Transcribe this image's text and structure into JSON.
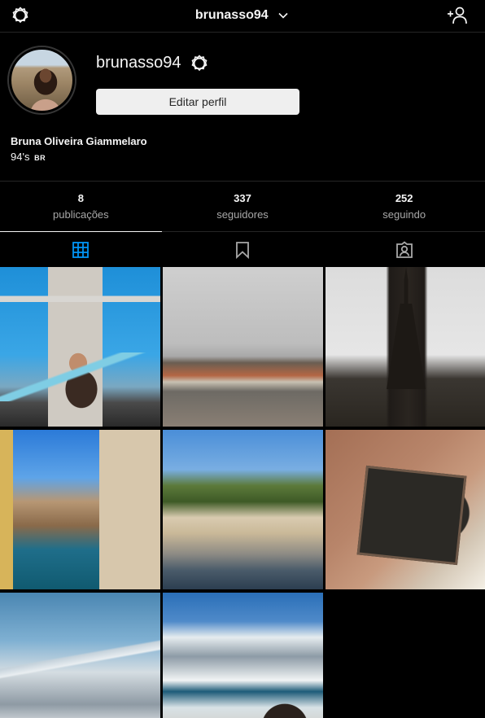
{
  "header": {
    "username": "brunasso94",
    "settings_icon": "gear-icon",
    "dropdown_icon": "chevron-down-icon",
    "add_user_icon": "add-user-icon"
  },
  "profile": {
    "username": "brunasso94",
    "edit_button": "Editar perfil",
    "full_name": "Bruna Oliveira Giammelaro",
    "bio_text": "94's",
    "bio_flag": "BR"
  },
  "stats": [
    {
      "value": "8",
      "label": "publicações"
    },
    {
      "value": "337",
      "label": "seguidores"
    },
    {
      "value": "252",
      "label": "seguindo"
    }
  ],
  "tabs": [
    {
      "icon": "grid-icon",
      "active": true
    },
    {
      "icon": "bookmark-icon",
      "active": false
    },
    {
      "icon": "tagged-icon",
      "active": false
    }
  ],
  "colors": {
    "background": "#000000",
    "active_tab_icon": "#0095f6",
    "muted_text": "#a8a8a8",
    "button_bg": "#efefef"
  },
  "posts": [
    {
      "subject": "Tower Bridge selfie"
    },
    {
      "subject": "Prague castle over river"
    },
    {
      "subject": "Scott Monument"
    },
    {
      "subject": "Venice canal gondolas"
    },
    {
      "subject": "Verona hillside"
    },
    {
      "subject": "Memorial plaque"
    },
    {
      "subject": "Mountains from airplane"
    },
    {
      "subject": "Snowy mountain lake"
    }
  ]
}
